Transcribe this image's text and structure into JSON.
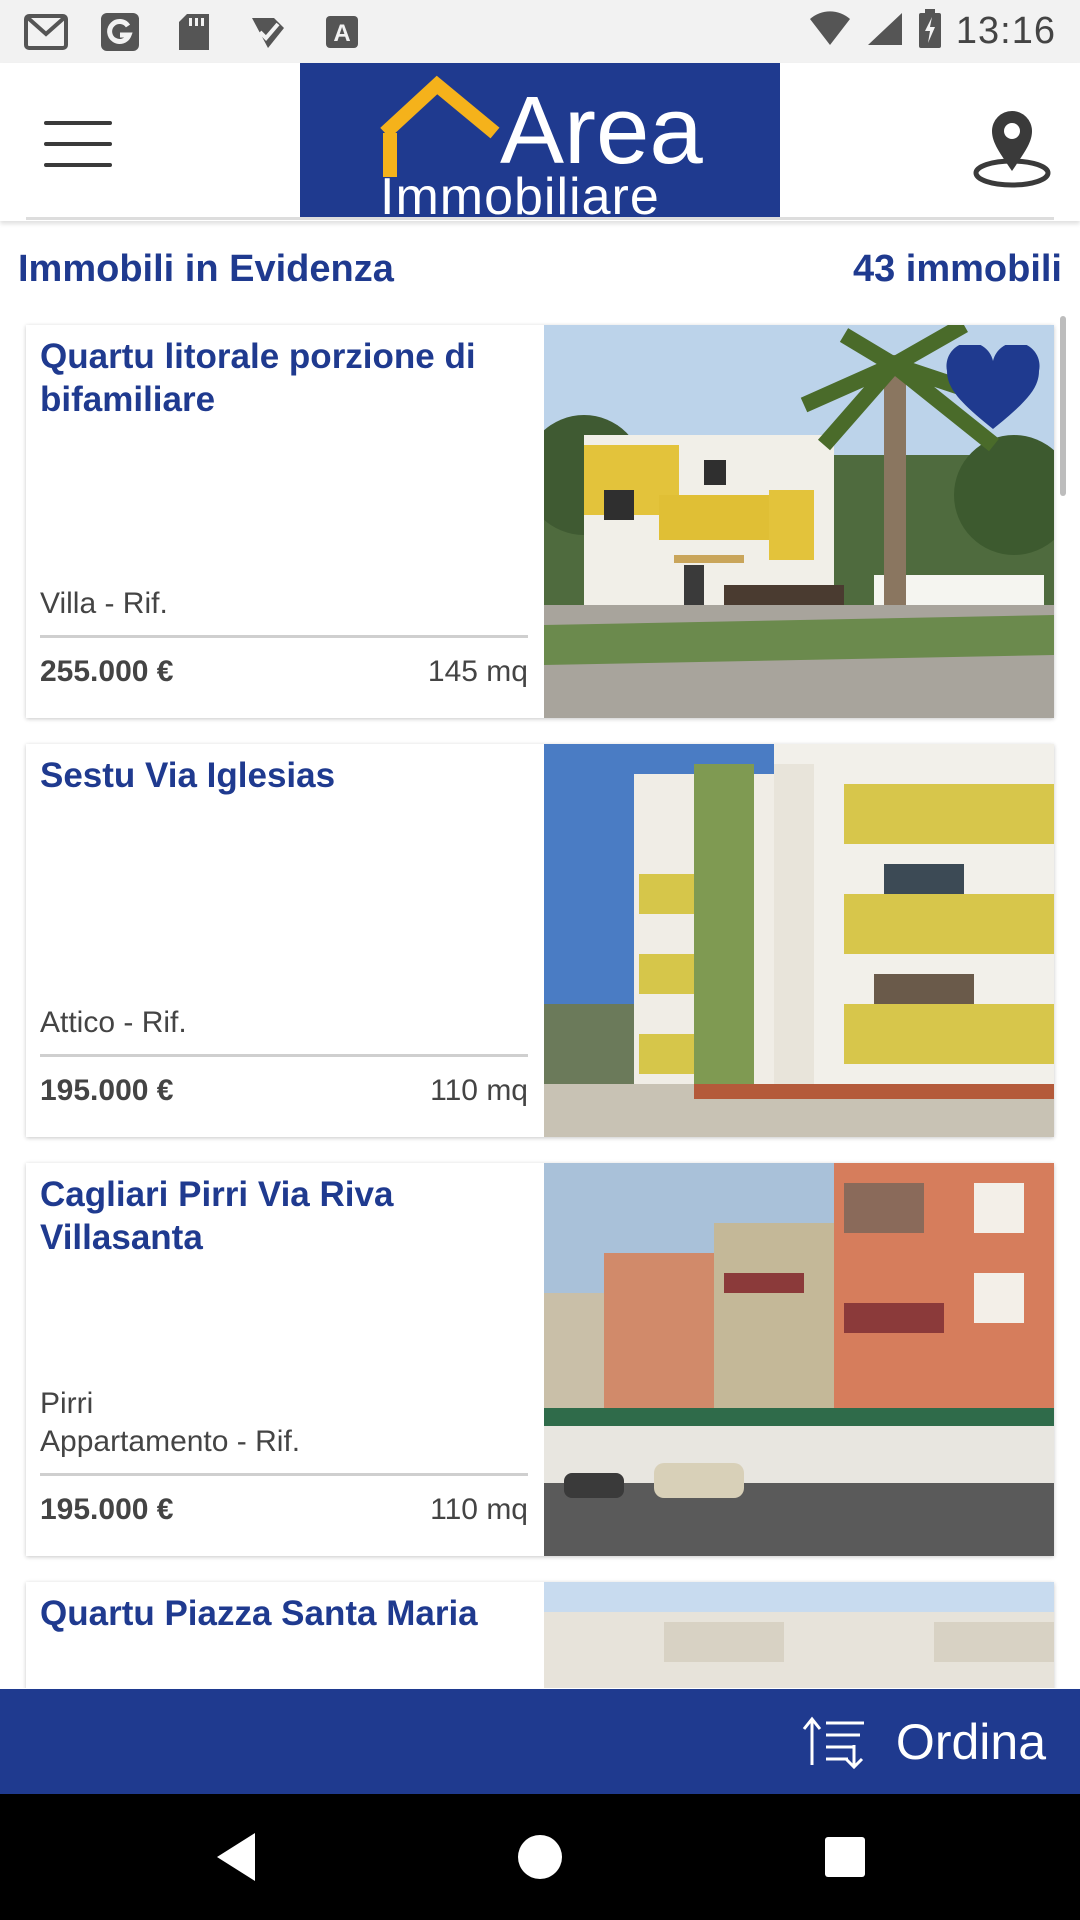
{
  "status_bar": {
    "time": "13:16",
    "left_icons": [
      "gmail-icon",
      "google-icon",
      "sd-card-icon",
      "check-icon",
      "a-icon"
    ],
    "right_icons": [
      "wifi-icon",
      "signal-icon",
      "battery-icon"
    ]
  },
  "header": {
    "logo_word1": "Area",
    "logo_word2": "Immobiliare",
    "menu_icon": "menu-icon",
    "map_icon": "map-pin-icon"
  },
  "section": {
    "title": "Immobili in Evidenza",
    "count": "43 immobili"
  },
  "listings": [
    {
      "title": "Quartu litorale porzione di bifamiliare",
      "type": "Villa - Rif.",
      "price": "255.000 €",
      "size": "145 mq",
      "favorite": true
    },
    {
      "title": "Sestu Via Iglesias",
      "type": "Attico - Rif.",
      "price": "195.000 €",
      "size": "110 mq",
      "favorite": false
    },
    {
      "title": "Cagliari Pirri Via Riva Villasanta",
      "locality": "Pirri",
      "type": "Appartamento - Rif.",
      "price": "195.000 €",
      "size": "110 mq",
      "favorite": false
    },
    {
      "title": "Quartu Piazza Santa Maria"
    }
  ],
  "sort": {
    "label": "Ordina",
    "icon": "sort-icon"
  },
  "nav": {
    "back_icon": "back-icon",
    "home_icon": "home-icon",
    "recents_icon": "recents-icon"
  },
  "colors": {
    "brand": "#1f3a8f",
    "accent": "#f5b21b",
    "text": "#444444"
  }
}
